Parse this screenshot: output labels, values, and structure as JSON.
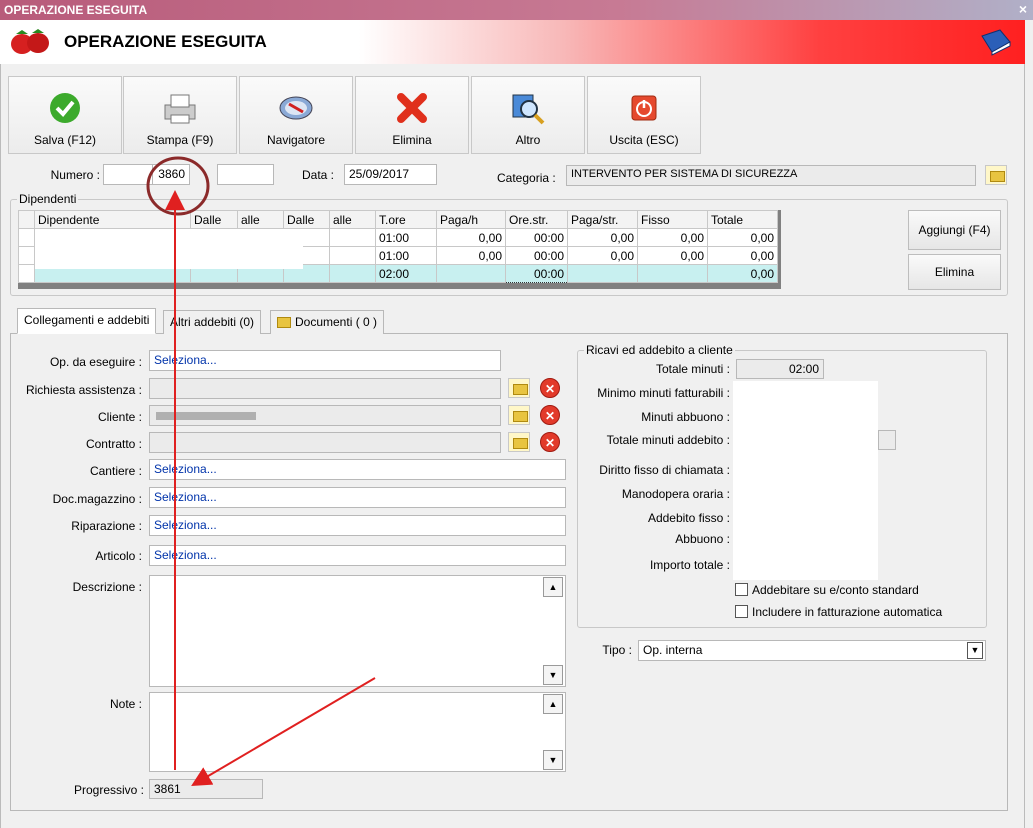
{
  "window": {
    "title": "OPERAZIONE ESEGUITA",
    "header_title": "OPERAZIONE ESEGUITA",
    "close": "×"
  },
  "toolbar": {
    "save": "Salva (F12)",
    "print": "Stampa (F9)",
    "navigator": "Navigatore",
    "delete": "Elimina",
    "other": "Altro",
    "exit": "Uscita (ESC)"
  },
  "top": {
    "numero_label": "Numero :",
    "numero": "3860",
    "data_label": "Data :",
    "data": "25/09/2017",
    "categoria_label": "Categoria :",
    "categoria": "INTERVENTO PER SISTEMA DI SICUREZZA"
  },
  "dipendenti": {
    "title": "Dipendenti",
    "columns": [
      "Dipendente",
      "Dalle",
      "alle",
      "Dalle",
      "alle",
      "T.ore",
      "Paga/h",
      "Ore.str.",
      "Paga/str.",
      "Fisso",
      "Totale"
    ],
    "rows": [
      [
        "01:00",
        "0,00",
        "00:00",
        "0,00",
        "0,00",
        "0,00"
      ],
      [
        "01:00",
        "0,00",
        "00:00",
        "0,00",
        "0,00",
        "0,00"
      ]
    ],
    "total_row": {
      "tore": "02:00",
      "orestr": "00:00",
      "totale": "0,00"
    },
    "add_button": "Aggiungi (F4)",
    "delete_button": "Elimina"
  },
  "tabs": [
    "Collegamenti e addebiti",
    "Altri addebiti (0)",
    "Documenti ( 0 )"
  ],
  "form": {
    "op_label": "Op. da eseguire :",
    "op_value": "Seleziona...",
    "richiesta_label": "Richiesta assistenza :",
    "cliente_label": "Cliente :",
    "contratto_label": "Contratto :",
    "cantiere_label": "Cantiere :",
    "cantiere_value": "Seleziona...",
    "docmag_label": "Doc.magazzino :",
    "docmag_value": "Seleziona...",
    "riparazione_label": "Riparazione :",
    "riparazione_value": "Seleziona...",
    "articolo_label": "Articolo :",
    "articolo_value": "Seleziona...",
    "descrizione_label": "Descrizione :",
    "note_label": "Note :",
    "progressivo_label": "Progressivo :",
    "progressivo": "3861"
  },
  "ricavi": {
    "title": "Ricavi ed addebito a cliente",
    "totale_minuti_label": "Totale minuti :",
    "totale_minuti": "02:00",
    "minimo_label": "Minimo minuti fatturabili :",
    "abbuono_min_label": "Minuti abbuono :",
    "tot_addebito_label": "Totale minuti addebito :",
    "diritto_label": "Diritto fisso di chiamata :",
    "manodopera_label": "Manodopera oraria :",
    "addebito_fisso_label": "Addebito fisso :",
    "abbuono_label": "Abbuono :",
    "importo_label": "Importo totale :",
    "chk1": "Addebitare su e/conto standard",
    "chk2": "Includere in fatturazione automatica"
  },
  "tipo": {
    "label": "Tipo :",
    "value": "Op. interna"
  },
  "colors": {
    "annotation": "#e02020",
    "circle": "#8b2a2a",
    "selected_row": "#c8f0f0"
  }
}
